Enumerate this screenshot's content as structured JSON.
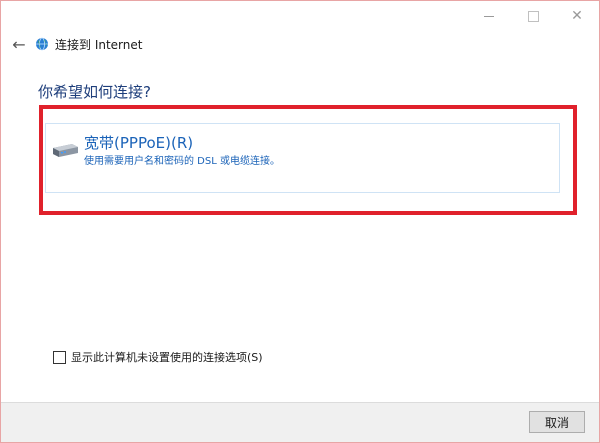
{
  "window": {
    "title": "连接到 Internet"
  },
  "controls": {
    "minimize_icon": "minimize-icon",
    "maximize_icon": "maximize-icon",
    "close_icon": "close-icon",
    "close_glyph": "✕"
  },
  "nav": {
    "back_glyph": "←",
    "title": "连接到 Internet"
  },
  "main": {
    "heading": "你希望如何连接?",
    "options": [
      {
        "title": "宽带(PPPoE)(R)",
        "description": "使用需要用户名和密码的 DSL 或电缆连接。",
        "icon": "broadband-modem-icon"
      }
    ]
  },
  "checkbox": {
    "label": "显示此计算机未设置使用的连接选项(S)",
    "checked": false
  },
  "footer": {
    "cancel_label": "取消"
  },
  "colors": {
    "heading": "#1e3e7b",
    "option_text": "#1b63b8",
    "highlight": "#e0212b",
    "card_border": "#cfe3f5"
  }
}
